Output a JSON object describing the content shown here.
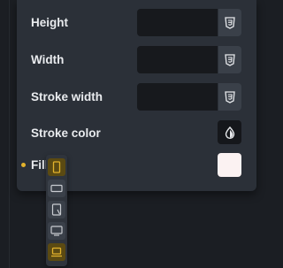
{
  "properties": {
    "height_label": "Height",
    "width_label": "Width",
    "stroke_width_label": "Stroke width",
    "stroke_color_label": "Stroke color",
    "fill_label": "Fill",
    "fill_color": "#fbf2f2",
    "unit_icon": "css3-icon",
    "color_picker_icon": "color-drop-icon"
  },
  "breakpoints": [
    {
      "name": "mobile-portrait-icon",
      "active": true
    },
    {
      "name": "mobile-landscape-icon",
      "active": false
    },
    {
      "name": "tablet-icon",
      "active": false
    },
    {
      "name": "desktop-icon",
      "active": false
    },
    {
      "name": "laptop-icon",
      "active": true
    }
  ],
  "colors": {
    "accent": "#e2b22c",
    "panel": "#2b3038",
    "input": "#17191d"
  }
}
